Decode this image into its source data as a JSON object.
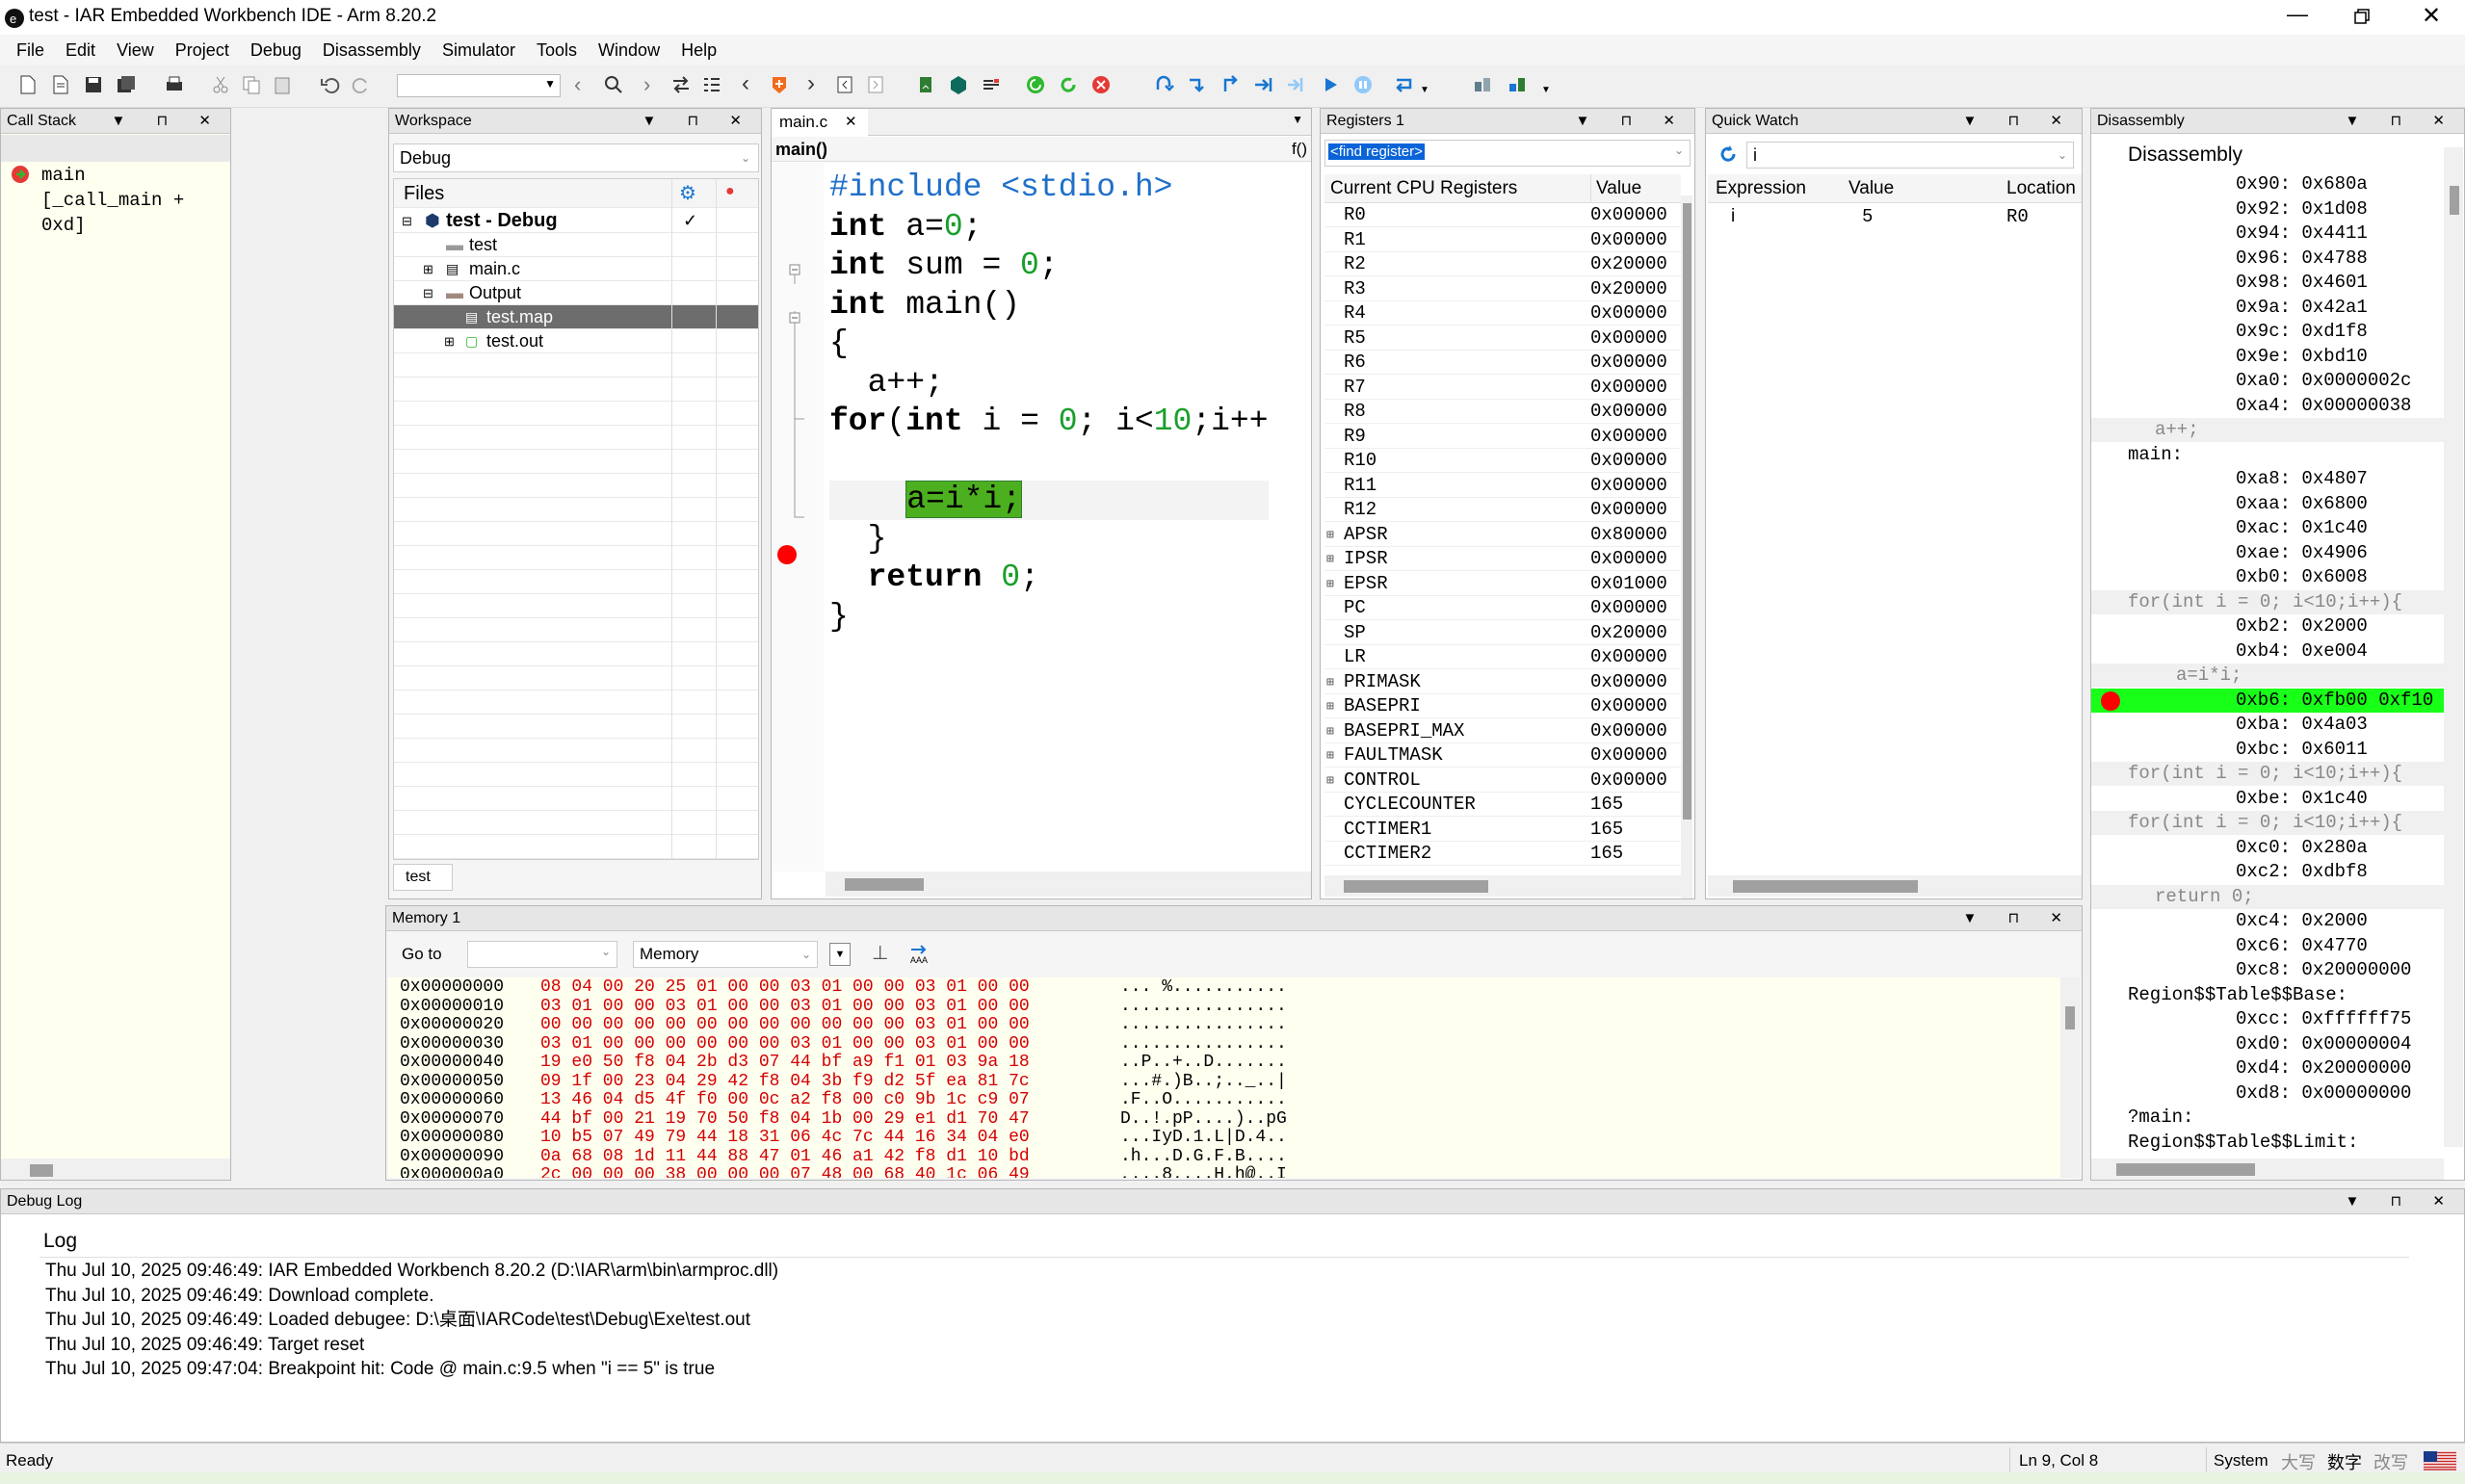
{
  "window": {
    "title": "test - IAR Embedded Workbench IDE - Arm 8.20.2"
  },
  "menu": [
    "File",
    "Edit",
    "View",
    "Project",
    "Debug",
    "Disassembly",
    "Simulator",
    "Tools",
    "Window",
    "Help"
  ],
  "callstack": {
    "title": "Call Stack",
    "items": [
      "main",
      "[_call_main + 0xd]"
    ]
  },
  "workspace": {
    "title": "Workspace",
    "config": "Debug",
    "files_header": "Files",
    "tab": "test",
    "tree": [
      {
        "label": "test - Debug"
      },
      {
        "label": "test"
      },
      {
        "label": "main.c"
      },
      {
        "label": "Output"
      },
      {
        "label": "test.map"
      },
      {
        "label": "test.out"
      }
    ]
  },
  "editor": {
    "tab": "main.c",
    "func": "main()",
    "fbtn": "f()",
    "lines": [
      [
        {
          "t": "#include <stdio.h>",
          "c": "blue"
        }
      ],
      [
        {
          "t": "int",
          "c": "kw"
        },
        {
          "t": " a=",
          "c": ""
        },
        {
          "t": "0",
          "c": "green"
        },
        {
          "t": ";",
          "c": ""
        }
      ],
      [
        {
          "t": "int",
          "c": "kw"
        },
        {
          "t": " sum = ",
          "c": ""
        },
        {
          "t": "0",
          "c": "green"
        },
        {
          "t": ";",
          "c": ""
        }
      ],
      [
        {
          "t": "int",
          "c": "kw"
        },
        {
          "t": " main()",
          "c": ""
        }
      ],
      [
        {
          "t": "{",
          "c": ""
        }
      ],
      [
        {
          "t": "  a++;",
          "c": ""
        }
      ],
      [
        {
          "t": "for",
          "c": "kw"
        },
        {
          "t": "(",
          "c": ""
        },
        {
          "t": "int",
          "c": "kw"
        },
        {
          "t": " i = ",
          "c": ""
        },
        {
          "t": "0",
          "c": "green"
        },
        {
          "t": "; i<",
          "c": ""
        },
        {
          "t": "10",
          "c": "green"
        },
        {
          "t": ";i++",
          "c": ""
        }
      ],
      [
        {
          "t": "",
          "c": ""
        }
      ],
      [
        {
          "t": "    a=i*i;",
          "c": "hlr"
        }
      ],
      [
        {
          "t": "  }",
          "c": ""
        }
      ],
      [
        {
          "t": "  ",
          "c": ""
        },
        {
          "t": "return",
          "c": "kw"
        },
        {
          "t": " ",
          "c": ""
        },
        {
          "t": "0",
          "c": "green"
        },
        {
          "t": ";",
          "c": ""
        }
      ],
      [
        {
          "t": "}",
          "c": ""
        }
      ]
    ]
  },
  "registers": {
    "title": "Registers 1",
    "find": "<find register>",
    "col1": "Current CPU Registers",
    "col2": "Value",
    "rows": [
      [
        "R0",
        "0x00000"
      ],
      [
        "R1",
        "0x00000"
      ],
      [
        "R2",
        "0x20000"
      ],
      [
        "R3",
        "0x20000"
      ],
      [
        "R4",
        "0x00000"
      ],
      [
        "R5",
        "0x00000"
      ],
      [
        "R6",
        "0x00000"
      ],
      [
        "R7",
        "0x00000"
      ],
      [
        "R8",
        "0x00000"
      ],
      [
        "R9",
        "0x00000"
      ],
      [
        "R10",
        "0x00000"
      ],
      [
        "R11",
        "0x00000"
      ],
      [
        "R12",
        "0x00000"
      ],
      [
        "APSR",
        "0x80000"
      ],
      [
        "IPSR",
        "0x00000"
      ],
      [
        "EPSR",
        "0x01000"
      ],
      [
        "PC",
        "0x00000"
      ],
      [
        "SP",
        "0x20000"
      ],
      [
        "LR",
        "0x00000"
      ],
      [
        "PRIMASK",
        "0x00000"
      ],
      [
        "BASEPRI",
        "0x00000"
      ],
      [
        "BASEPRI_MAX",
        "0x00000"
      ],
      [
        "FAULTMASK",
        "0x00000"
      ],
      [
        "CONTROL",
        "0x00000"
      ],
      [
        "CYCLECOUNTER",
        "165"
      ],
      [
        "CCTIMER1",
        "165"
      ],
      [
        "CCTIMER2",
        "165"
      ]
    ]
  },
  "quickwatch": {
    "title": "Quick Watch",
    "input": "i",
    "cols": [
      "Expression",
      "Value",
      "Location"
    ],
    "rows": [
      [
        "i",
        "5",
        "R0"
      ]
    ]
  },
  "disassembly": {
    "title": "Disassembly",
    "label": "Disassembly",
    "lines": [
      {
        "t": "0x90: 0x680a",
        "k": "i"
      },
      {
        "t": "0x92: 0x1d08",
        "k": "i"
      },
      {
        "t": "0x94: 0x4411",
        "k": "i"
      },
      {
        "t": "0x96: 0x4788",
        "k": "i"
      },
      {
        "t": "0x98: 0x4601",
        "k": "i"
      },
      {
        "t": "0x9a: 0x42a1",
        "k": "i"
      },
      {
        "t": "0x9c: 0xd1f8",
        "k": "i"
      },
      {
        "t": "0x9e: 0xbd10",
        "k": "i"
      },
      {
        "t": "0xa0: 0x0000002c",
        "k": "i"
      },
      {
        "t": "0xa4: 0x00000038",
        "k": "i"
      },
      {
        "t": "a++;",
        "k": "s2"
      },
      {
        "t": "main:",
        "k": "l"
      },
      {
        "t": "0xa8: 0x4807",
        "k": "i"
      },
      {
        "t": "0xaa: 0x6800",
        "k": "i"
      },
      {
        "t": "0xac: 0x1c40",
        "k": "i"
      },
      {
        "t": "0xae: 0x4906",
        "k": "i"
      },
      {
        "t": "0xb0: 0x6008",
        "k": "i"
      },
      {
        "t": "for(int i = 0; i<10;i++){",
        "k": "s"
      },
      {
        "t": "0xb2: 0x2000",
        "k": "i"
      },
      {
        "t": "0xb4: 0xe004",
        "k": "i"
      },
      {
        "t": "a=i*i;",
        "k": "s3"
      },
      {
        "t": "0xb6: 0xfb00 0xf10",
        "k": "cur"
      },
      {
        "t": "0xba: 0x4a03",
        "k": "i"
      },
      {
        "t": "0xbc: 0x6011",
        "k": "i"
      },
      {
        "t": "for(int i = 0; i<10;i++){",
        "k": "s"
      },
      {
        "t": "0xbe: 0x1c40",
        "k": "i"
      },
      {
        "t": "for(int i = 0; i<10;i++){",
        "k": "s"
      },
      {
        "t": "0xc0: 0x280a",
        "k": "i"
      },
      {
        "t": "0xc2: 0xdbf8",
        "k": "i"
      },
      {
        "t": "return 0;",
        "k": "s2"
      },
      {
        "t": "0xc4: 0x2000",
        "k": "i"
      },
      {
        "t": "0xc6: 0x4770",
        "k": "i"
      },
      {
        "t": "0xc8: 0x20000000",
        "k": "i"
      },
      {
        "t": "Region$$Table$$Base:",
        "k": "l"
      },
      {
        "t": "0xcc: 0xffffff75",
        "k": "i"
      },
      {
        "t": "0xd0: 0x00000004",
        "k": "i"
      },
      {
        "t": "0xd4: 0x20000000",
        "k": "i"
      },
      {
        "t": "0xd8: 0x00000000",
        "k": "i"
      },
      {
        "t": "?main:",
        "k": "l"
      },
      {
        "t": "Region$$Table$$Limit:",
        "k": "l"
      }
    ]
  },
  "memory": {
    "title": "Memory 1",
    "goto": "Go to",
    "zone": "Memory",
    "rows": [
      {
        "a": "0x00000000",
        "h": "08 04 00 20 25 01 00 00 03 01 00 00 03 01 00 00",
        "s": "... %..........."
      },
      {
        "a": "0x00000010",
        "h": "03 01 00 00 03 01 00 00 03 01 00 00 03 01 00 00",
        "s": "................"
      },
      {
        "a": "0x00000020",
        "h": "00 00 00 00 00 00 00 00 00 00 00 00 03 01 00 00",
        "s": "................"
      },
      {
        "a": "0x00000030",
        "h": "03 01 00 00 00 00 00 00 03 01 00 00 03 01 00 00",
        "s": "................"
      },
      {
        "a": "0x00000040",
        "h": "19 e0 50 f8 04 2b d3 07 44 bf a9 f1 01 03 9a 18",
        "s": "..P..+..D......."
      },
      {
        "a": "0x00000050",
        "h": "09 1f 00 23 04 29 42 f8 04 3b f9 d2 5f ea 81 7c",
        "s": "...#.)B..;.._..|"
      },
      {
        "a": "0x00000060",
        "h": "13 46 04 d5 4f f0 00 0c a2 f8 00 c0 9b 1c c9 07",
        "s": ".F..O..........."
      },
      {
        "a": "0x00000070",
        "h": "44 bf 00 21 19 70 50 f8 04 1b 00 29 e1 d1 70 47",
        "s": "D..!.pP....)..pG"
      },
      {
        "a": "0x00000080",
        "h": "10 b5 07 49 79 44 18 31 06 4c 7c 44 16 34 04 e0",
        "s": "...IyD.1.L|D.4.."
      },
      {
        "a": "0x00000090",
        "h": "0a 68 08 1d 11 44 88 47 01 46 a1 42 f8 d1 10 bd",
        "s": ".h...D.G.F.B...."
      },
      {
        "a": "0x000000a0",
        "h": "2c 00 00 00 38 00 00 00 07 48 00 68 40 1c 06 49",
        "s": ",...8....H.h@..I"
      }
    ]
  },
  "debuglog": {
    "title": "Debug Log",
    "header": "Log",
    "lines": [
      "Thu Jul 10, 2025 09:46:49: IAR Embedded Workbench 8.20.2 (D:\\IAR\\arm\\bin\\armproc.dll)",
      "Thu Jul 10, 2025 09:46:49: Download complete.",
      "Thu Jul 10, 2025 09:46:49: Loaded debugee: D:\\桌面\\IARCode\\test\\Debug\\Exe\\test.out",
      "Thu Jul 10, 2025 09:46:49: Target reset",
      "Thu Jul 10, 2025 09:47:04: Breakpoint hit: Code @ main.c:9.5 when \"i == 5\" is true"
    ]
  },
  "status": {
    "left": "Ready",
    "pos": "Ln 9, Col 8",
    "system": "System",
    "caps": "大写",
    "num": "数字",
    "ovr": "改写"
  },
  "colors": {
    "highlight": "#18ff18",
    "breakpoint": "#ff0000",
    "keyword": "#000000",
    "include": "#1f6fc9",
    "number": "#1a9e2b",
    "memchanged": "#d40000"
  }
}
